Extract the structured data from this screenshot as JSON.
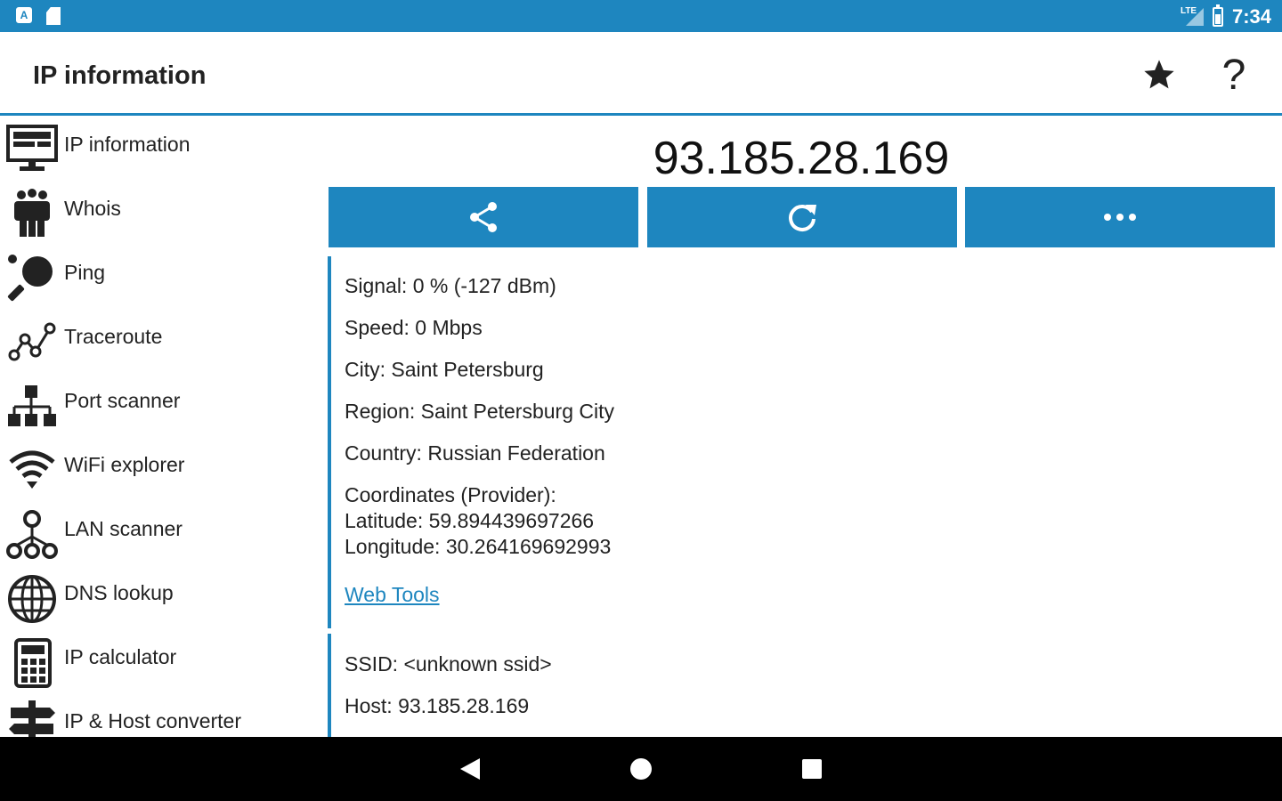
{
  "status_bar": {
    "time": "7:34",
    "network_label": "LTE"
  },
  "app_bar": {
    "title": "IP information",
    "star_icon": "star-icon",
    "help_icon": "help-icon",
    "help_glyph": "?"
  },
  "sidebar": {
    "items": [
      {
        "label": "IP information",
        "icon": "monitor-icon"
      },
      {
        "label": "Whois",
        "icon": "people-icon"
      },
      {
        "label": "Ping",
        "icon": "ping-pong-icon"
      },
      {
        "label": "Traceroute",
        "icon": "route-icon"
      },
      {
        "label": "Port scanner",
        "icon": "network-icon"
      },
      {
        "label": "WiFi explorer",
        "icon": "wifi-icon"
      },
      {
        "label": "LAN scanner",
        "icon": "lan-icon"
      },
      {
        "label": "DNS lookup",
        "icon": "globe-icon"
      },
      {
        "label": "IP calculator",
        "icon": "calculator-icon"
      },
      {
        "label": "IP & Host converter",
        "icon": "signpost-icon"
      }
    ]
  },
  "main": {
    "ip_address": "93.185.28.169",
    "buttons": {
      "share_icon": "share-icon",
      "refresh_icon": "refresh-icon",
      "more_icon": "more-icon"
    },
    "info": {
      "signal": "Signal: 0 % (-127 dBm)",
      "speed": "Speed: 0 Mbps",
      "city": "City: Saint Petersburg",
      "region": "Region: Saint Petersburg City",
      "country": "Country: Russian Federation",
      "coordinates_header": "Coordinates (Provider):",
      "latitude": "Latitude: 59.894439697266",
      "longitude": "Longitude: 30.264169692993",
      "web_tools_link": "Web Tools"
    },
    "network": {
      "ssid": "SSID: <unknown ssid>",
      "host": "Host: 93.185.28.169"
    }
  },
  "colors": {
    "accent": "#1e86bf",
    "text": "#222222",
    "nav_bar": "#000000"
  }
}
